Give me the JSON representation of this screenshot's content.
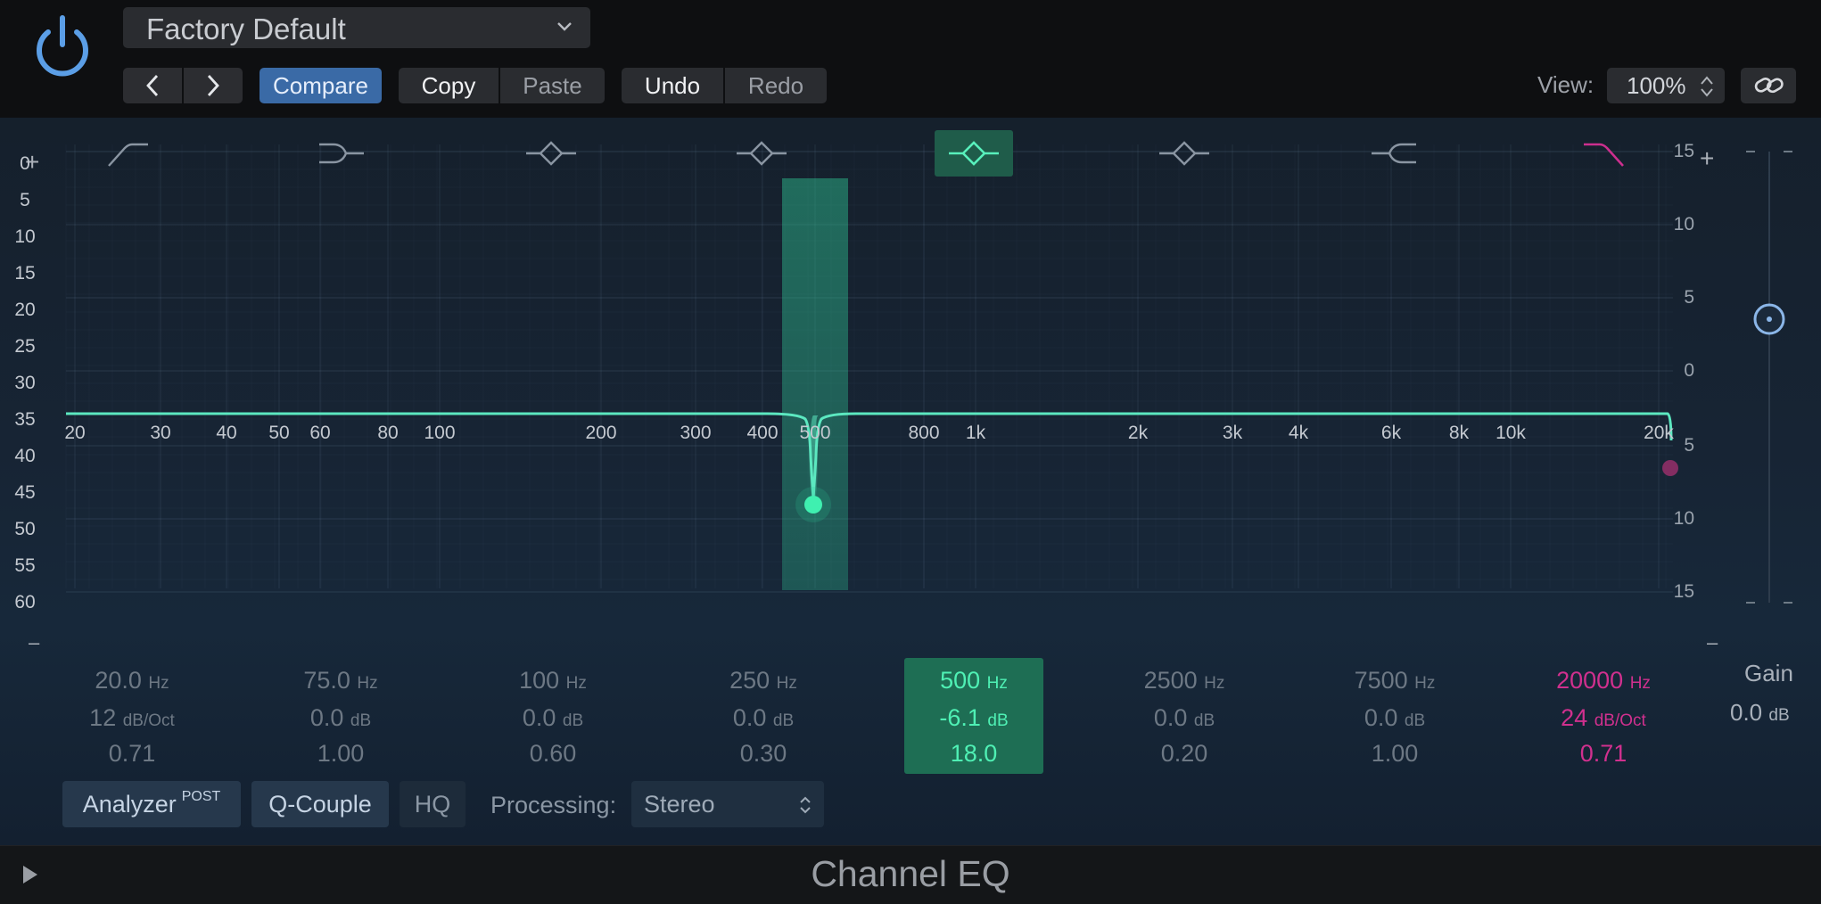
{
  "header": {
    "preset_name": "Factory Default",
    "compare_label": "Compare",
    "copy_label": "Copy",
    "paste_label": "Paste",
    "undo_label": "Undo",
    "redo_label": "Redo",
    "view_label": "View:",
    "view_value": "100%"
  },
  "graph": {
    "freq_ticks": [
      "20",
      "30",
      "40",
      "50",
      "60",
      "80",
      "100",
      "200",
      "300",
      "400",
      "500",
      "800",
      "1k",
      "2k",
      "3k",
      "4k",
      "6k",
      "8k",
      "10k",
      "20k"
    ],
    "left_scale": [
      "0",
      "5",
      "10",
      "15",
      "20",
      "25",
      "30",
      "35",
      "40",
      "45",
      "50",
      "55",
      "60"
    ],
    "right_scale": [
      "15",
      "10",
      "5",
      "0",
      "5",
      "10",
      "15"
    ],
    "plus_symbol": "+",
    "minus_symbol": "–"
  },
  "bands": [
    {
      "freq": "20.0",
      "freq_unit": "Hz",
      "gain": "12",
      "gain_unit": "dB/Oct",
      "q": "0.71",
      "type": "low-cut-icon"
    },
    {
      "freq": "75.0",
      "freq_unit": "Hz",
      "gain": "0.0",
      "gain_unit": "dB",
      "q": "1.00",
      "type": "low-shelf-icon"
    },
    {
      "freq": "100",
      "freq_unit": "Hz",
      "gain": "0.0",
      "gain_unit": "dB",
      "q": "0.60",
      "type": "bell-icon"
    },
    {
      "freq": "250",
      "freq_unit": "Hz",
      "gain": "0.0",
      "gain_unit": "dB",
      "q": "0.30",
      "type": "bell-icon"
    },
    {
      "freq": "500",
      "freq_unit": "Hz",
      "gain": "-6.1",
      "gain_unit": "dB",
      "q": "18.0",
      "type": "bell-icon",
      "selected": true
    },
    {
      "freq": "2500",
      "freq_unit": "Hz",
      "gain": "0.0",
      "gain_unit": "dB",
      "q": "0.20",
      "type": "bell-icon"
    },
    {
      "freq": "7500",
      "freq_unit": "Hz",
      "gain": "0.0",
      "gain_unit": "dB",
      "q": "1.00",
      "type": "high-shelf-icon"
    },
    {
      "freq": "20000",
      "freq_unit": "Hz",
      "gain": "24",
      "gain_unit": "dB/Oct",
      "q": "0.71",
      "type": "high-cut-icon"
    }
  ],
  "gain": {
    "label": "Gain",
    "value": "0.0",
    "unit": "dB"
  },
  "controls": {
    "analyzer_label": "Analyzer",
    "analyzer_mode": "POST",
    "qcouple_label": "Q-Couple",
    "hq_label": "HQ",
    "processing_label": "Processing:",
    "processing_value": "Stereo"
  },
  "footer": {
    "title": "Channel EQ"
  },
  "colors": {
    "accent_green": "#4ff0b4",
    "accent_blue": "#3a6aa6",
    "accent_magenta": "#d0308e",
    "curve": "#5ce8c0"
  }
}
